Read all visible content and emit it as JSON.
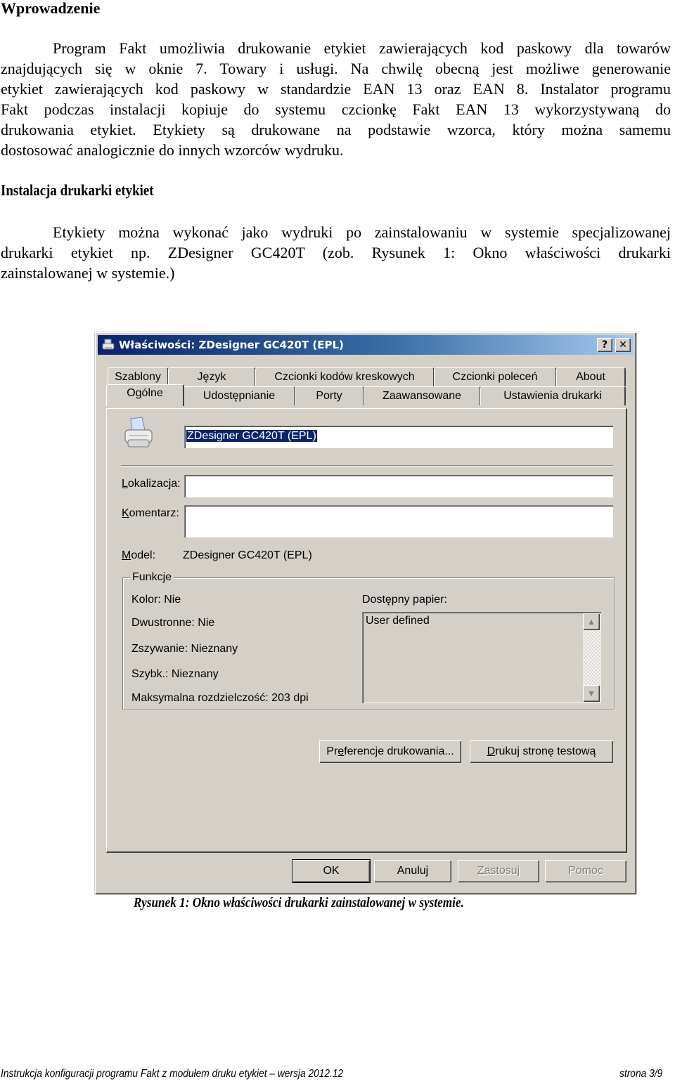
{
  "document": {
    "heading1": "Wprowadzenie",
    "paragraph1": [
      "Program Fakt umożliwia drukowanie etykiet zawierających kod paskowy dla towarów",
      "znajdujących się w oknie 7. Towary i usługi.  Na chwilę obecną jest możliwe generowanie",
      "etykiet zawierających kod paskowy w standardzie EAN 13 oraz EAN 8. Instalator programu",
      "Fakt podczas instalacji kopiuje do systemu czcionkę Fakt EAN 13 wykorzystywaną do",
      "drukowania etykiet. Etykiety są drukowane na podstawie wzorca, który można samemu",
      "dostosować analogicznie do innych wzorców wydruku."
    ],
    "heading2": "Instalacja drukarki etykiet",
    "paragraph2": [
      "Etykiety można wykonać jako wydruki po zainstalowaniu w systemie specjalizowanej",
      "drukarki etykiet np. ZDesigner GC420T (zob. Rysunek 1: Okno właściwości drukarki",
      "zainstalowanej w systemie.)"
    ],
    "caption": "Rysunek 1: Okno właściwości drukarki zainstalowanej w systemie.",
    "footer_left": "Instrukcja konfiguracji programu Fakt z modułem druku etykiet – wersja 2012.12",
    "footer_right": "strona 3/9"
  },
  "dialog": {
    "title": "Właściwości: ZDesigner GC420T (EPL)",
    "help_button": "?",
    "close_button": "✕",
    "tabs_row1": [
      "Szablony",
      "Język",
      "Czcionki kodów kreskowych",
      "Czcionki poleceń",
      "About"
    ],
    "tabs_row2": [
      "Ogólne",
      "Udostępnianie",
      "Porty",
      "Zaawansowane",
      "Ustawienia drukarki"
    ],
    "active_tab": "Ogólne",
    "printer_name_value": "ZDesigner GC420T (EPL)",
    "location_label_accel": "L",
    "location_label_rest": "okalizacja:",
    "location_value": "",
    "comment_label_accel": "K",
    "comment_label_rest": "omentarz:",
    "comment_value": "",
    "model_label_accel": "M",
    "model_label_rest": "odel:",
    "model_value": "ZDesigner GC420T (EPL)",
    "features": {
      "title": "Funkcje",
      "color": "Kolor: Nie",
      "duplex": "Dwustronne: Nie",
      "staple": "Zszywanie: Nieznany",
      "speed": "Szybk.: Nieznany",
      "max_resolution": "Maksymalna rozdzielczość: 203  dpi",
      "paper_label": "Dostępny papier:",
      "paper_items": [
        "User defined"
      ]
    },
    "pref_button_pre": "Pr",
    "pref_button_accel": "e",
    "pref_button_post": "ferencje drukowania...",
    "test_button_accel": "D",
    "test_button_rest": "rukuj stronę testową",
    "ok_button": "OK",
    "cancel_button": "Anuluj",
    "apply_button_accel": "Z",
    "apply_button_rest": "astosuj",
    "help_bottom_button": "Pomoc"
  }
}
